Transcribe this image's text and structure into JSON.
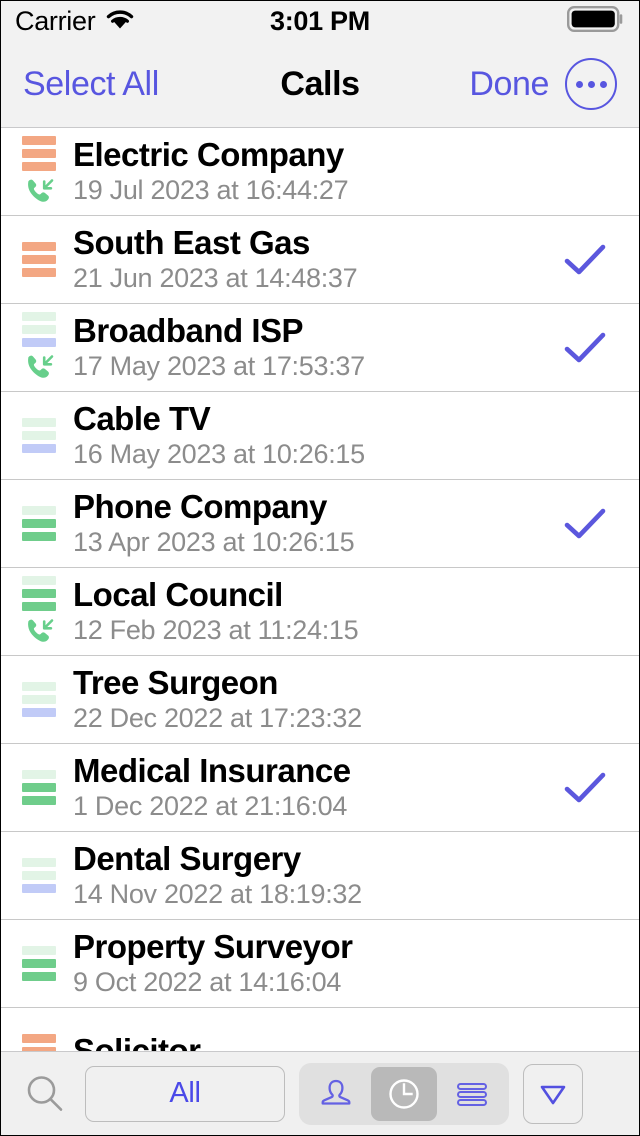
{
  "status_bar": {
    "carrier": "Carrier",
    "time": "3:01 PM",
    "wifi_icon": "wifi-icon",
    "battery_icon": "battery-full-icon"
  },
  "nav_bar": {
    "select_all_label": "Select All",
    "title": "Calls",
    "done_label": "Done",
    "more_icon": "more-ellipsis-icon"
  },
  "colors": {
    "accent": "#5856e0",
    "accent_text": "#4b49e8",
    "check": "#5b57dd",
    "bar_salmon": "#f3a783",
    "bar_green_solid": "#6fcd8b",
    "bar_green_pale": "#e2f4e6",
    "bar_blue": "#c1cbf7",
    "phone_green": "#67cf8b",
    "subtitle": "#8c8c8c",
    "separator": "#c8c8c8",
    "chrome": "#f2f2f2",
    "toolbar": "#f0f0f0"
  },
  "calls": [
    {
      "name": "Electric Company",
      "timestamp": "19 Jul 2023 at 16:44:27",
      "bars": [
        "salmon",
        "salmon",
        "salmon"
      ],
      "has_phone_icon": true,
      "selected": false
    },
    {
      "name": "South East Gas",
      "timestamp": "21 Jun 2023 at 14:48:37",
      "bars": [
        "salmon",
        "salmon",
        "salmon"
      ],
      "has_phone_icon": false,
      "selected": true
    },
    {
      "name": "Broadband ISP",
      "timestamp": "17 May 2023 at 17:53:37",
      "bars": [
        "pale",
        "pale",
        "blue"
      ],
      "has_phone_icon": true,
      "selected": true
    },
    {
      "name": "Cable TV",
      "timestamp": "16 May 2023 at 10:26:15",
      "bars": [
        "pale",
        "pale",
        "blue"
      ],
      "has_phone_icon": false,
      "selected": false
    },
    {
      "name": "Phone Company",
      "timestamp": "13 Apr 2023 at 10:26:15",
      "bars": [
        "pale",
        "green",
        "green"
      ],
      "has_phone_icon": false,
      "selected": true
    },
    {
      "name": "Local Council",
      "timestamp": "12 Feb 2023 at 11:24:15",
      "bars": [
        "pale",
        "green",
        "green"
      ],
      "has_phone_icon": true,
      "selected": false
    },
    {
      "name": "Tree Surgeon",
      "timestamp": "22 Dec 2022 at 17:23:32",
      "bars": [
        "pale",
        "pale",
        "blue"
      ],
      "has_phone_icon": false,
      "selected": false
    },
    {
      "name": "Medical Insurance",
      "timestamp": "1 Dec 2022 at 21:16:04",
      "bars": [
        "pale",
        "green",
        "green"
      ],
      "has_phone_icon": false,
      "selected": true
    },
    {
      "name": "Dental Surgery",
      "timestamp": "14 Nov 2022 at 18:19:32",
      "bars": [
        "pale",
        "pale",
        "blue"
      ],
      "has_phone_icon": false,
      "selected": false
    },
    {
      "name": "Property Surveyor",
      "timestamp": "9 Oct 2022 at 14:16:04",
      "bars": [
        "pale",
        "green",
        "green"
      ],
      "has_phone_icon": false,
      "selected": false
    },
    {
      "name": "Solicitor",
      "timestamp": "",
      "bars": [
        "salmon",
        "salmon",
        "salmon"
      ],
      "has_phone_icon": false,
      "selected": false
    }
  ],
  "toolbar": {
    "search_icon": "search-icon",
    "filter_label": "All",
    "segments": [
      {
        "icon": "person-icon",
        "selected": false
      },
      {
        "icon": "clock-icon",
        "selected": true
      },
      {
        "icon": "list-lines-icon",
        "selected": false
      }
    ],
    "filter_icon": "filter-triangle-icon"
  }
}
